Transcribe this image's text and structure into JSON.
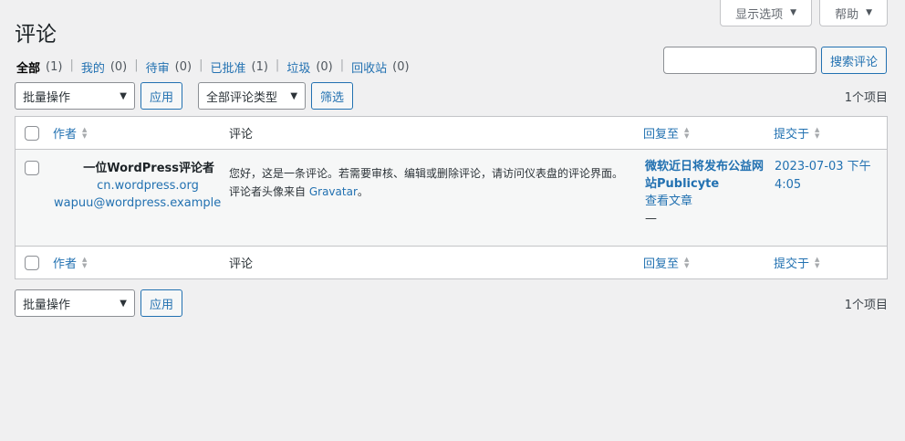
{
  "screen_meta": {
    "screen_options": "显示选项",
    "help": "帮助"
  },
  "page": {
    "title": "评论"
  },
  "filters": [
    {
      "label": "全部",
      "count": "(1)"
    },
    {
      "label": "我的",
      "count": "(0)"
    },
    {
      "label": "待审",
      "count": "(0)"
    },
    {
      "label": "已批准",
      "count": "(1)"
    },
    {
      "label": "垃圾",
      "count": "(0)"
    },
    {
      "label": "回收站",
      "count": "(0)"
    }
  ],
  "search": {
    "value": "",
    "button": "搜索评论"
  },
  "tablenav": {
    "bulk_action": "批量操作",
    "apply": "应用",
    "comment_type": "全部评论类型",
    "filter": "筛选",
    "item_count": "1个项目"
  },
  "columns": {
    "author": "作者",
    "comment": "评论",
    "response": "回复至",
    "date": "提交于"
  },
  "comment": {
    "author_name": "一位WordPress评论者",
    "author_url": "cn.wordpress.org",
    "author_email": "wapuu@wordpress.example",
    "text": "您好，这是一条评论。若需要审核、编辑或删除评论，请访问仪表盘的评论界面。评论者头像来自",
    "text_link": "Gravatar",
    "text_end": "。",
    "response_title": "微软近日将发布公益网站Publicyte",
    "view_post": "查看文章",
    "dash": "—",
    "date": "2023-07-03 下午4:05"
  }
}
